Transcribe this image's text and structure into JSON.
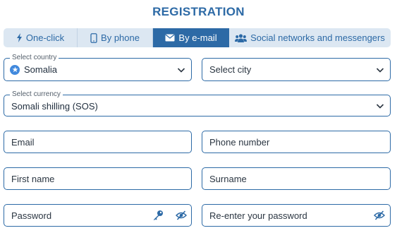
{
  "title": "REGISTRATION",
  "tabs": [
    {
      "label": "One-click",
      "icon": "lightning-icon"
    },
    {
      "label": "By phone",
      "icon": "phone-icon"
    },
    {
      "label": "By e-mail",
      "icon": "envelope-icon",
      "active": true
    },
    {
      "label": "Social networks and messengers",
      "icon": "users-icon"
    }
  ],
  "country": {
    "legend": "Select country",
    "value": "Somalia"
  },
  "city": {
    "placeholder": "Select city"
  },
  "currency": {
    "legend": "Select currency",
    "value": "Somali shilling (SOS)"
  },
  "email": {
    "placeholder": "Email"
  },
  "phone": {
    "placeholder": "Phone number"
  },
  "first_name": {
    "placeholder": "First name"
  },
  "surname": {
    "placeholder": "Surname"
  },
  "password": {
    "placeholder": "Password"
  },
  "password_repeat": {
    "placeholder": "Re-enter your password"
  },
  "colors": {
    "accent": "#2d6aa6",
    "tab_bg": "#dce7f2",
    "text": "#1f2d3d"
  }
}
